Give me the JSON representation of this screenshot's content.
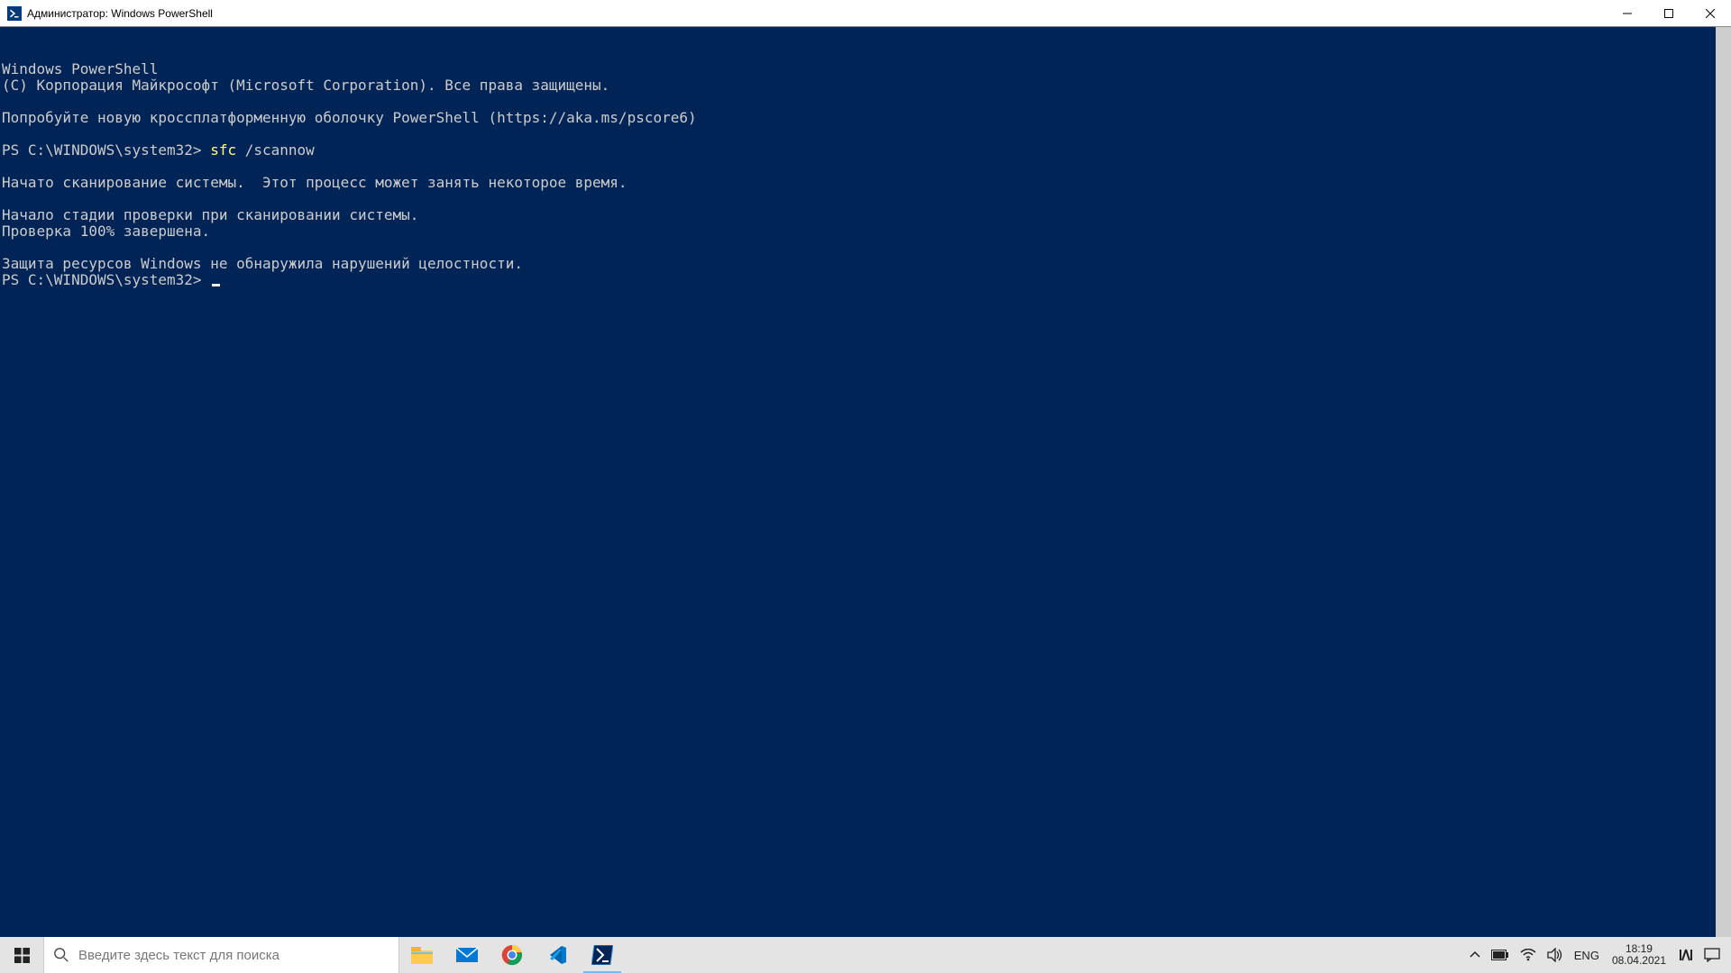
{
  "titlebar": {
    "title": "Администратор: Windows PowerShell"
  },
  "console": {
    "line1": "Windows PowerShell",
    "line2": "(C) Корпорация Майкрософт (Microsoft Corporation). Все права защищены.",
    "blank1": "",
    "line3": "Попробуйте новую кроссплатформенную оболочку PowerShell (https://aka.ms/pscore6)",
    "blank2": "",
    "prompt1_prefix": "PS C:\\WINDOWS\\system32> ",
    "prompt1_cmd": "sfc ",
    "prompt1_arg": "/scannow",
    "blank3": "",
    "line4": "Начато сканирование системы.  Этот процесс может занять некоторое время.",
    "blank4": "",
    "line5": "Начало стадии проверки при сканировании системы.",
    "line6": "Проверка 100% завершена.",
    "blank5": "",
    "line7": "Защита ресурсов Windows не обнаружила нарушений целостности.",
    "prompt2": "PS C:\\WINDOWS\\system32> "
  },
  "taskbar": {
    "search_placeholder": "Введите здесь текст для поиска",
    "lang": "ENG",
    "time": "18:19",
    "date": "08.04.2021"
  },
  "icons": {
    "start": "windows-icon",
    "search": "search-icon",
    "explorer": "file-explorer-icon",
    "mail": "mail-icon",
    "chrome": "chrome-icon",
    "vscode": "vscode-icon",
    "powershell": "powershell-icon",
    "tray_up": "chevron-up-icon",
    "battery": "battery-icon",
    "wifi": "wifi-icon",
    "sound": "speaker-icon",
    "ime": "ime-icon",
    "action": "action-center-icon"
  }
}
